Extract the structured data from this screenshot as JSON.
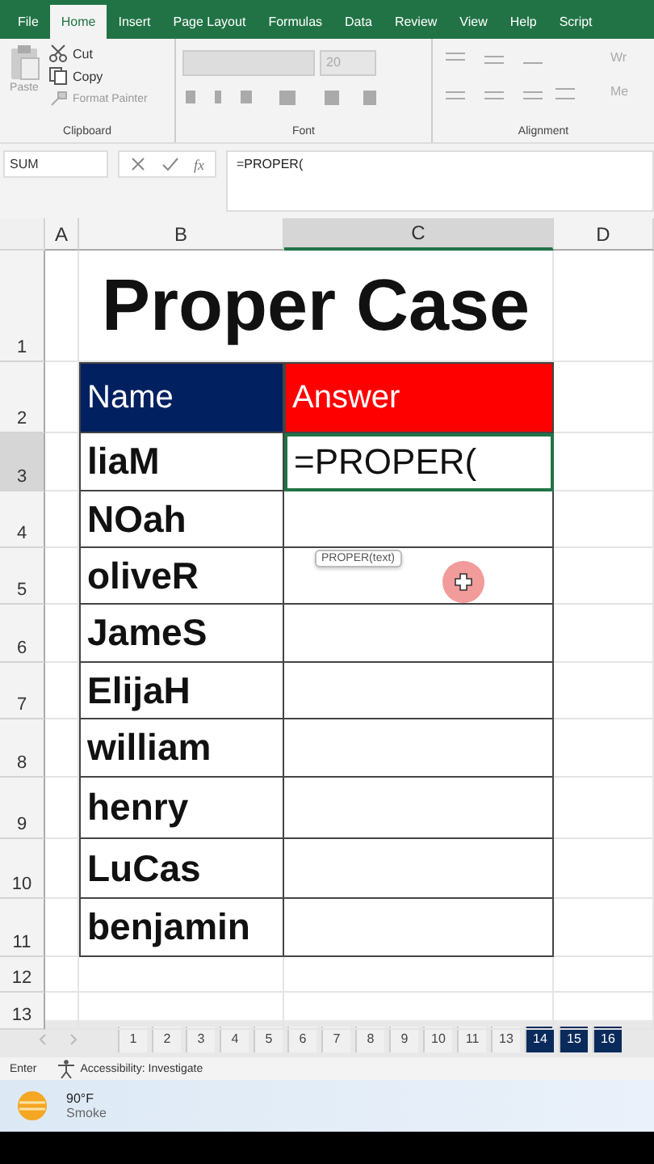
{
  "menu_tabs": [
    {
      "label": "File",
      "selected": false
    },
    {
      "label": "Home",
      "selected": true
    },
    {
      "label": "Insert",
      "selected": false
    },
    {
      "label": "Page Layout",
      "selected": false
    },
    {
      "label": "Formulas",
      "selected": false
    },
    {
      "label": "Data",
      "selected": false
    },
    {
      "label": "Review",
      "selected": false
    },
    {
      "label": "View",
      "selected": false
    },
    {
      "label": "Help",
      "selected": false
    },
    {
      "label": "Script",
      "selected": false
    }
  ],
  "ribbon": {
    "clipboard": {
      "paste": "Paste",
      "cut": "Cut",
      "copy": "Copy",
      "format_painter": "Format Painter",
      "label": "Clipboard"
    },
    "font": {
      "size": "20",
      "label": "Font"
    },
    "alignment": {
      "wrap": "Wr",
      "merge": "Me",
      "label": "Alignment"
    }
  },
  "formula_bar": {
    "name_box": "SUM",
    "function_button": "fx",
    "formula": "=PROPER("
  },
  "sheet": {
    "columns": [
      {
        "label": "A",
        "selected": false
      },
      {
        "label": "B",
        "selected": false
      },
      {
        "label": "C",
        "selected": true
      },
      {
        "label": "D",
        "selected": false
      }
    ],
    "rows": [
      {
        "label": "1",
        "selected": false
      },
      {
        "label": "2",
        "selected": false
      },
      {
        "label": "3",
        "selected": true
      },
      {
        "label": "4",
        "selected": false
      },
      {
        "label": "5",
        "selected": false
      },
      {
        "label": "6",
        "selected": false
      },
      {
        "label": "7",
        "selected": false
      },
      {
        "label": "8",
        "selected": false
      },
      {
        "label": "9",
        "selected": false
      },
      {
        "label": "10",
        "selected": false
      },
      {
        "label": "11",
        "selected": false
      },
      {
        "label": "12",
        "selected": false
      },
      {
        "label": "13",
        "selected": false
      }
    ],
    "title": "Proper Case",
    "headers": [
      {
        "text": "Name",
        "color": "#002060"
      },
      {
        "text": "Answer",
        "color": "#ff0000"
      }
    ],
    "entries": [
      {
        "name": "liaM",
        "answer": "=PROPER(",
        "editing": true
      },
      {
        "name": "NOah",
        "editing": false
      },
      {
        "name": "oliveR",
        "editing": false
      },
      {
        "name": "JameS",
        "editing": false
      },
      {
        "name": "ElijaH",
        "editing": false
      },
      {
        "name": "william",
        "editing": false
      },
      {
        "name": "henry",
        "editing": false
      },
      {
        "name": "LuCas",
        "editing": false
      },
      {
        "name": "benjamin",
        "editing": false
      }
    ],
    "tooltip": "PROPER(text)"
  },
  "sheet_tabs": [
    {
      "label": "1",
      "color": "#f0f0f0"
    },
    {
      "label": "2",
      "color": "#f0f0f0"
    },
    {
      "label": "3",
      "color": "#f0f0f0"
    },
    {
      "label": "4",
      "color": "#f0f0f0"
    },
    {
      "label": "5",
      "color": "#f0f0f0"
    },
    {
      "label": "6",
      "color": "#f0f0f0"
    },
    {
      "label": "7",
      "color": "#f0f0f0"
    },
    {
      "label": "8",
      "color": "#f0f0f0"
    },
    {
      "label": "9",
      "color": "#f0f0f0"
    },
    {
      "label": "10",
      "color": "#f0f0f0"
    },
    {
      "label": "11",
      "color": "#f0f0f0"
    },
    {
      "label": "13",
      "color": "#f0f0f0"
    },
    {
      "label": "14",
      "color": "#0b2a5c"
    },
    {
      "label": "15",
      "color": "#0b2a5c"
    },
    {
      "label": "16",
      "color": "#0b2a5c"
    }
  ],
  "status_bar": {
    "mode": "Enter",
    "accessibility": "Accessibility: Investigate"
  },
  "weather": {
    "temperature": "90°F",
    "condition": "Smoke"
  }
}
